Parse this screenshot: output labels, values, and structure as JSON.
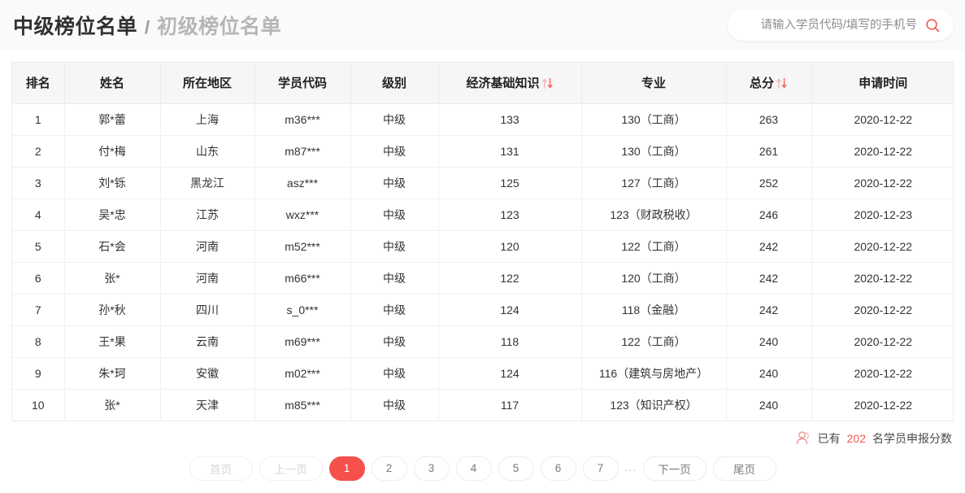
{
  "header": {
    "title_active": "中级榜位名单",
    "title_separator": "/",
    "title_inactive": "初级榜位名单",
    "search": {
      "placeholder": "请输入学员代码/填写的手机号",
      "value": "",
      "icon": "search-icon",
      "icon_color": "#f0574f"
    }
  },
  "table": {
    "columns": [
      {
        "label": "排名",
        "sortable": false
      },
      {
        "label": "姓名",
        "sortable": false
      },
      {
        "label": "所在地区",
        "sortable": false
      },
      {
        "label": "学员代码",
        "sortable": false
      },
      {
        "label": "级别",
        "sortable": false
      },
      {
        "label": "经济基础知识",
        "sortable": true
      },
      {
        "label": "专业",
        "sortable": false
      },
      {
        "label": "总分",
        "sortable": true
      },
      {
        "label": "申请时间",
        "sortable": false
      }
    ],
    "rows": [
      {
        "rank": "1",
        "name": "郭*蕾",
        "region": "上海",
        "code": "m36***",
        "level": "中级",
        "basic": "133",
        "major": "130（工商）",
        "total": "263",
        "date": "2020-12-22"
      },
      {
        "rank": "2",
        "name": "付*梅",
        "region": "山东",
        "code": "m87***",
        "level": "中级",
        "basic": "131",
        "major": "130（工商）",
        "total": "261",
        "date": "2020-12-22"
      },
      {
        "rank": "3",
        "name": "刘*铄",
        "region": "黑龙江",
        "code": "asz***",
        "level": "中级",
        "basic": "125",
        "major": "127（工商）",
        "total": "252",
        "date": "2020-12-22"
      },
      {
        "rank": "4",
        "name": "吴*忠",
        "region": "江苏",
        "code": "wxz***",
        "level": "中级",
        "basic": "123",
        "major": "123（财政税收）",
        "total": "246",
        "date": "2020-12-23"
      },
      {
        "rank": "5",
        "name": "石*会",
        "region": "河南",
        "code": "m52***",
        "level": "中级",
        "basic": "120",
        "major": "122（工商）",
        "total": "242",
        "date": "2020-12-22"
      },
      {
        "rank": "6",
        "name": "张*",
        "region": "河南",
        "code": "m66***",
        "level": "中级",
        "basic": "122",
        "major": "120（工商）",
        "total": "242",
        "date": "2020-12-22"
      },
      {
        "rank": "7",
        "name": "孙*秋",
        "region": "四川",
        "code": "s_0***",
        "level": "中级",
        "basic": "124",
        "major": "118（金融）",
        "total": "242",
        "date": "2020-12-22"
      },
      {
        "rank": "8",
        "name": "王*果",
        "region": "云南",
        "code": "m69***",
        "level": "中级",
        "basic": "118",
        "major": "122（工商）",
        "total": "240",
        "date": "2020-12-22"
      },
      {
        "rank": "9",
        "name": "朱*珂",
        "region": "安徽",
        "code": "m02***",
        "level": "中级",
        "basic": "124",
        "major": "116（建筑与房地产）",
        "total": "240",
        "date": "2020-12-22"
      },
      {
        "rank": "10",
        "name": "张*",
        "region": "天津",
        "code": "m85***",
        "level": "中级",
        "basic": "117",
        "major": "123（知识产权）",
        "total": "240",
        "date": "2020-12-22"
      }
    ]
  },
  "footer": {
    "icon": "person-icon",
    "text_prefix": "已有",
    "count": "202",
    "text_suffix": "名学员申报分数"
  },
  "pagination": {
    "first": "首页",
    "prev": "上一页",
    "pages": [
      "1",
      "2",
      "3",
      "4",
      "5",
      "6",
      "7"
    ],
    "active_page": "1",
    "ellipsis": "···",
    "next": "下一页",
    "last": "尾页",
    "active_color": "#f5504b"
  }
}
